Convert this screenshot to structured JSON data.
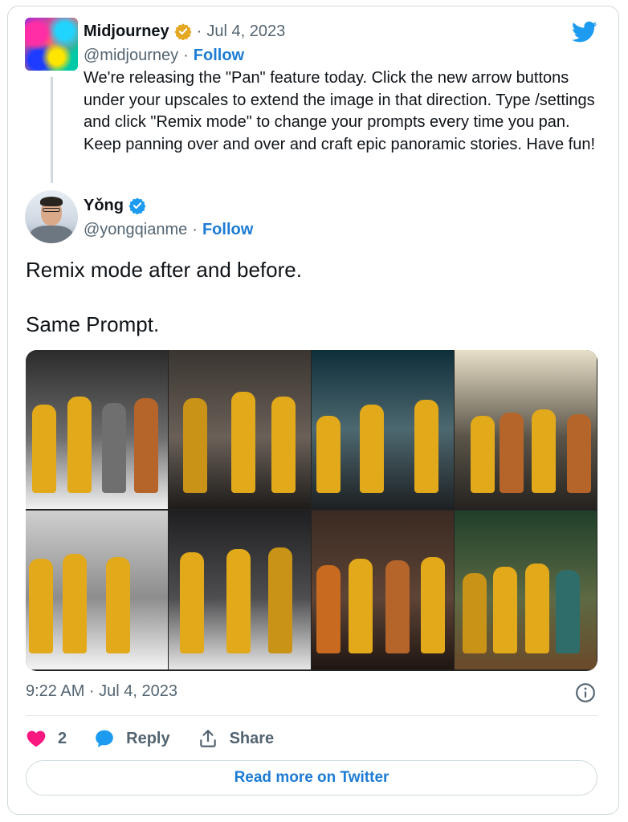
{
  "quoted_tweet": {
    "author_name": "Midjourney",
    "date": "Jul 4, 2023",
    "handle": "@midjourney",
    "follow_label": "Follow",
    "text": "We're releasing the \"Pan\" feature today. Click the new arrow buttons under your upscales to extend the image in that direction. Type /settings and click \"Remix mode\" to change your prompts every time you pan. Keep panning over and over and craft epic panoramic stories. Have fun!",
    "verified_badge": "gold-check-badge"
  },
  "tweet": {
    "author_name": "Yǒng",
    "handle": "@yongqianme",
    "follow_label": "Follow",
    "verified_badge": "blue-check-badge",
    "text_line1": "Remix mode after and before.",
    "text_line2": "Same Prompt.",
    "media": {
      "image_count": 8,
      "description_icon": "image-grid"
    },
    "timestamp": "9:22 AM · Jul 4, 2023",
    "like_count": "2",
    "reply_label": "Reply",
    "share_label": "Share",
    "read_more_label": "Read more on Twitter"
  },
  "icons": {
    "brand": "twitter-bird-icon",
    "info": "info-icon",
    "like": "heart-icon",
    "reply": "speech-bubble-icon",
    "share": "share-upload-icon"
  },
  "colors": {
    "twitter_blue": "#1d9bf0",
    "link_blue": "#1d7bd4",
    "heart_pink": "#f91880",
    "gold_badge": "#e5a823",
    "text_muted": "#536471",
    "border": "#cfd9de"
  }
}
